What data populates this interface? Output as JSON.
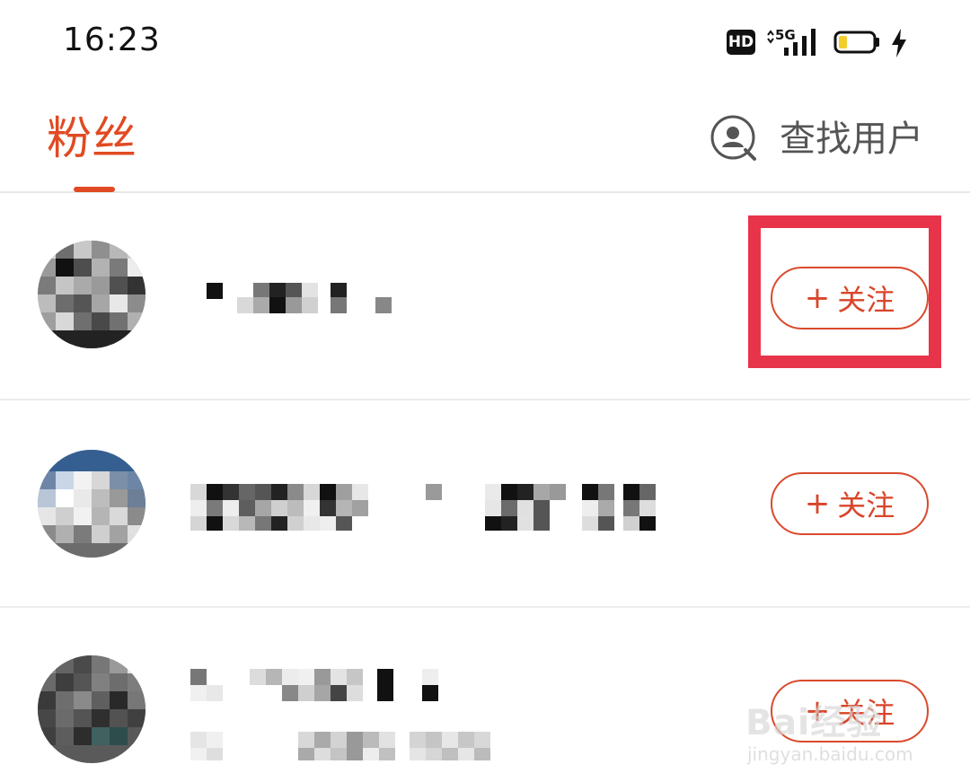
{
  "status_bar": {
    "time": "16:23",
    "hd_label": "HD",
    "network_label": "5G",
    "battery_icon": "battery-low-icon",
    "charging_icon": "charging-bolt-icon"
  },
  "header": {
    "active_tab_label": "粉丝",
    "find_user_label": "查找用户",
    "find_user_icon": "user-search-icon"
  },
  "followers": [
    {
      "display_name": "",
      "avatar_icon": "avatar-blurred",
      "follow_label": "关注",
      "follow_plus": "+"
    },
    {
      "display_name": "",
      "avatar_icon": "avatar-blurred",
      "follow_label": "关注",
      "follow_plus": "+"
    },
    {
      "display_name": "",
      "avatar_icon": "avatar-blurred",
      "follow_label": "关注",
      "follow_plus": "+"
    }
  ],
  "watermark": {
    "brand": "Bai经验",
    "url": "jingyan.baidu.com"
  },
  "colors": {
    "accent": "#e14a22",
    "highlight": "#e8344a",
    "divider": "#ececec"
  }
}
